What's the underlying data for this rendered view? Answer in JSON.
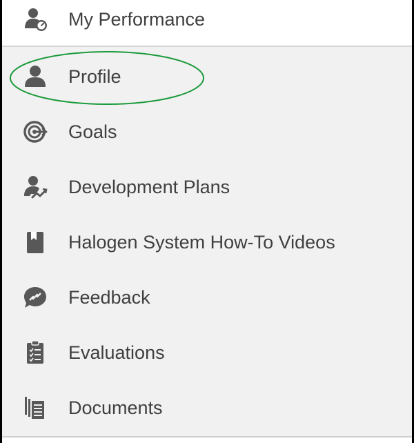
{
  "header": {
    "title": "My Performance",
    "icon": "person-speedometer-icon"
  },
  "menu": {
    "items": [
      {
        "id": "profile",
        "label": "Profile",
        "icon": "person-icon"
      },
      {
        "id": "goals",
        "label": "Goals",
        "icon": "target-icon"
      },
      {
        "id": "development-plans",
        "label": "Development Plans",
        "icon": "person-trend-icon"
      },
      {
        "id": "how-to-videos",
        "label": "Halogen System How-To Videos",
        "icon": "bookmark-book-icon"
      },
      {
        "id": "feedback",
        "label": "Feedback",
        "icon": "feedback-bubble-icon"
      },
      {
        "id": "evaluations",
        "label": "Evaluations",
        "icon": "clipboard-checklist-icon"
      },
      {
        "id": "documents",
        "label": "Documents",
        "icon": "documents-stack-icon"
      }
    ]
  },
  "annotation": {
    "highlight_color": "#1a9a3a",
    "highlighted_item": "Profile"
  },
  "colors": {
    "icon": "#585858",
    "text": "#3f3f3f",
    "menu_background": "#f1f1f1",
    "header_background": "#ffffff"
  }
}
